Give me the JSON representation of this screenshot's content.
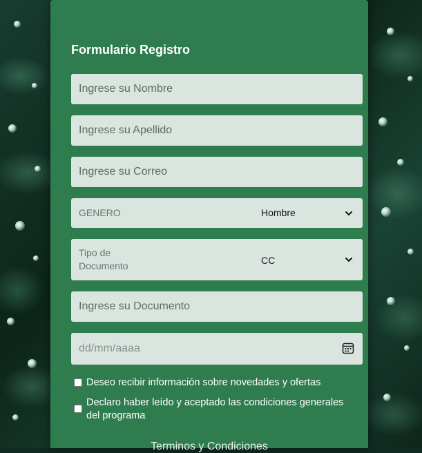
{
  "form": {
    "title": "Formulario Registro",
    "nombre_placeholder": "Ingrese su Nombre",
    "apellido_placeholder": "Ingrese su Apellido",
    "correo_placeholder": "Ingrese su Correo",
    "genero": {
      "label": "GENERO",
      "selected": "Hombre"
    },
    "tipo_documento": {
      "label_line1": "Tipo de",
      "label_line2": "Documento",
      "selected": "CC"
    },
    "documento_placeholder": "Ingrese su Documento",
    "fecha_placeholder": "dd/mm/aaaa",
    "checkbox_novedades": "Deseo recibir información sobre novedades y ofertas",
    "checkbox_condiciones_line1": "Declaro haber leído y aceptado las condiciones generales",
    "checkbox_condiciones_line2": "del programa",
    "terms_link": "Terminos y Condiciones"
  },
  "colors": {
    "panel": "#2f7d4f",
    "field_bg": "#dbe5e0",
    "text_white": "#ffffff"
  },
  "icons": [
    "chevron-down-icon",
    "calendar-icon"
  ]
}
